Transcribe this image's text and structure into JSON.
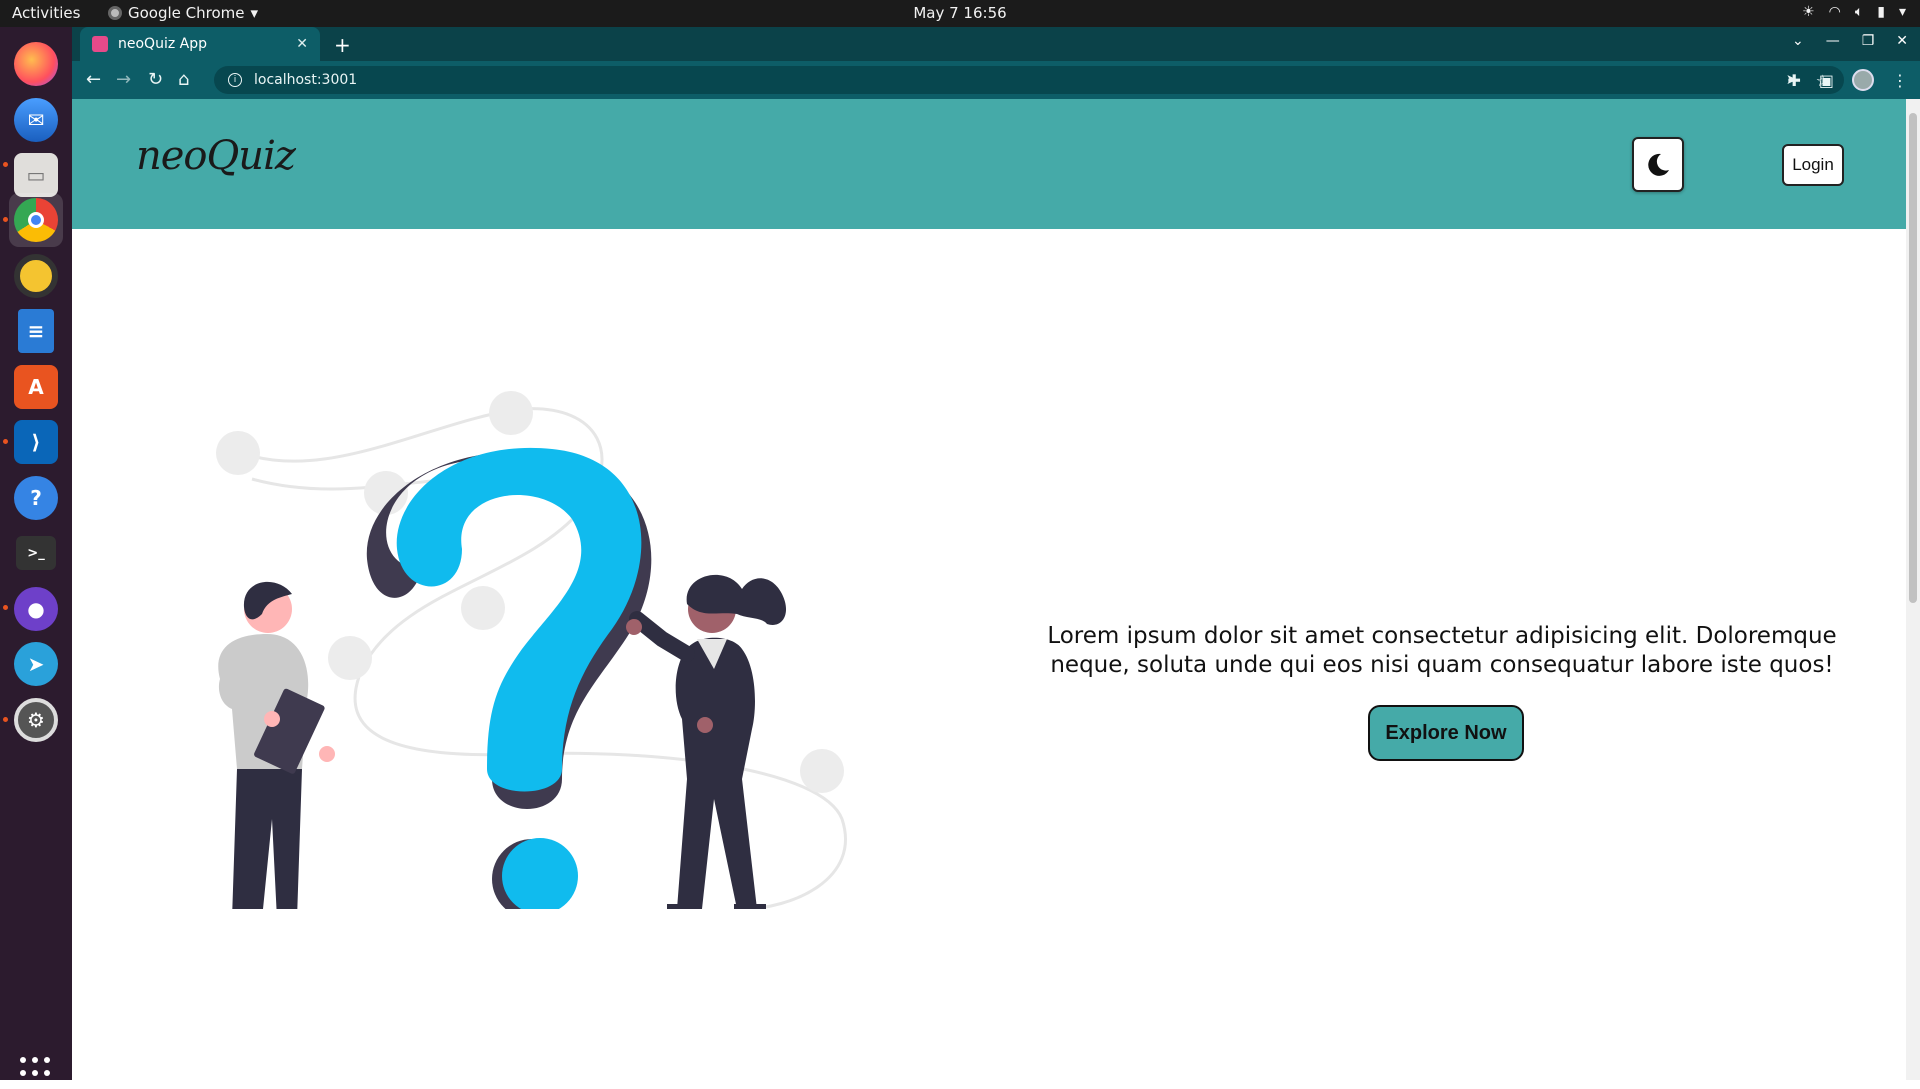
{
  "system_bar": {
    "activities": "Activities",
    "app_name": "Google Chrome",
    "datetime": "May 7  16:56"
  },
  "dock": {
    "items": [
      "Firefox",
      "Thunderbird",
      "Files",
      "Chrome",
      "Rhythmbox",
      "LibreOffice Writer",
      "Ubuntu Software",
      "VS Code",
      "Help",
      "Terminal",
      "GitHub Desktop",
      "Telegram",
      "Settings"
    ]
  },
  "browser": {
    "tab_title": "neoQuiz App",
    "url": "localhost:3001"
  },
  "page": {
    "logo": "neoQuiz",
    "login_label": "Login",
    "hero_text": "Lorem ipsum dolor sit amet consectetur adipisicing elit. Doloremque neque, soluta unde qui eos nisi quam consequatur labore iste quos!",
    "explore_label": "Explore Now"
  },
  "colors": {
    "navbar": "#45aaa8",
    "question_mark": "#10bbee",
    "question_shadow": "#3f3a4f",
    "figure_dark": "#2f2e41",
    "skin": "#ffb6b6"
  }
}
